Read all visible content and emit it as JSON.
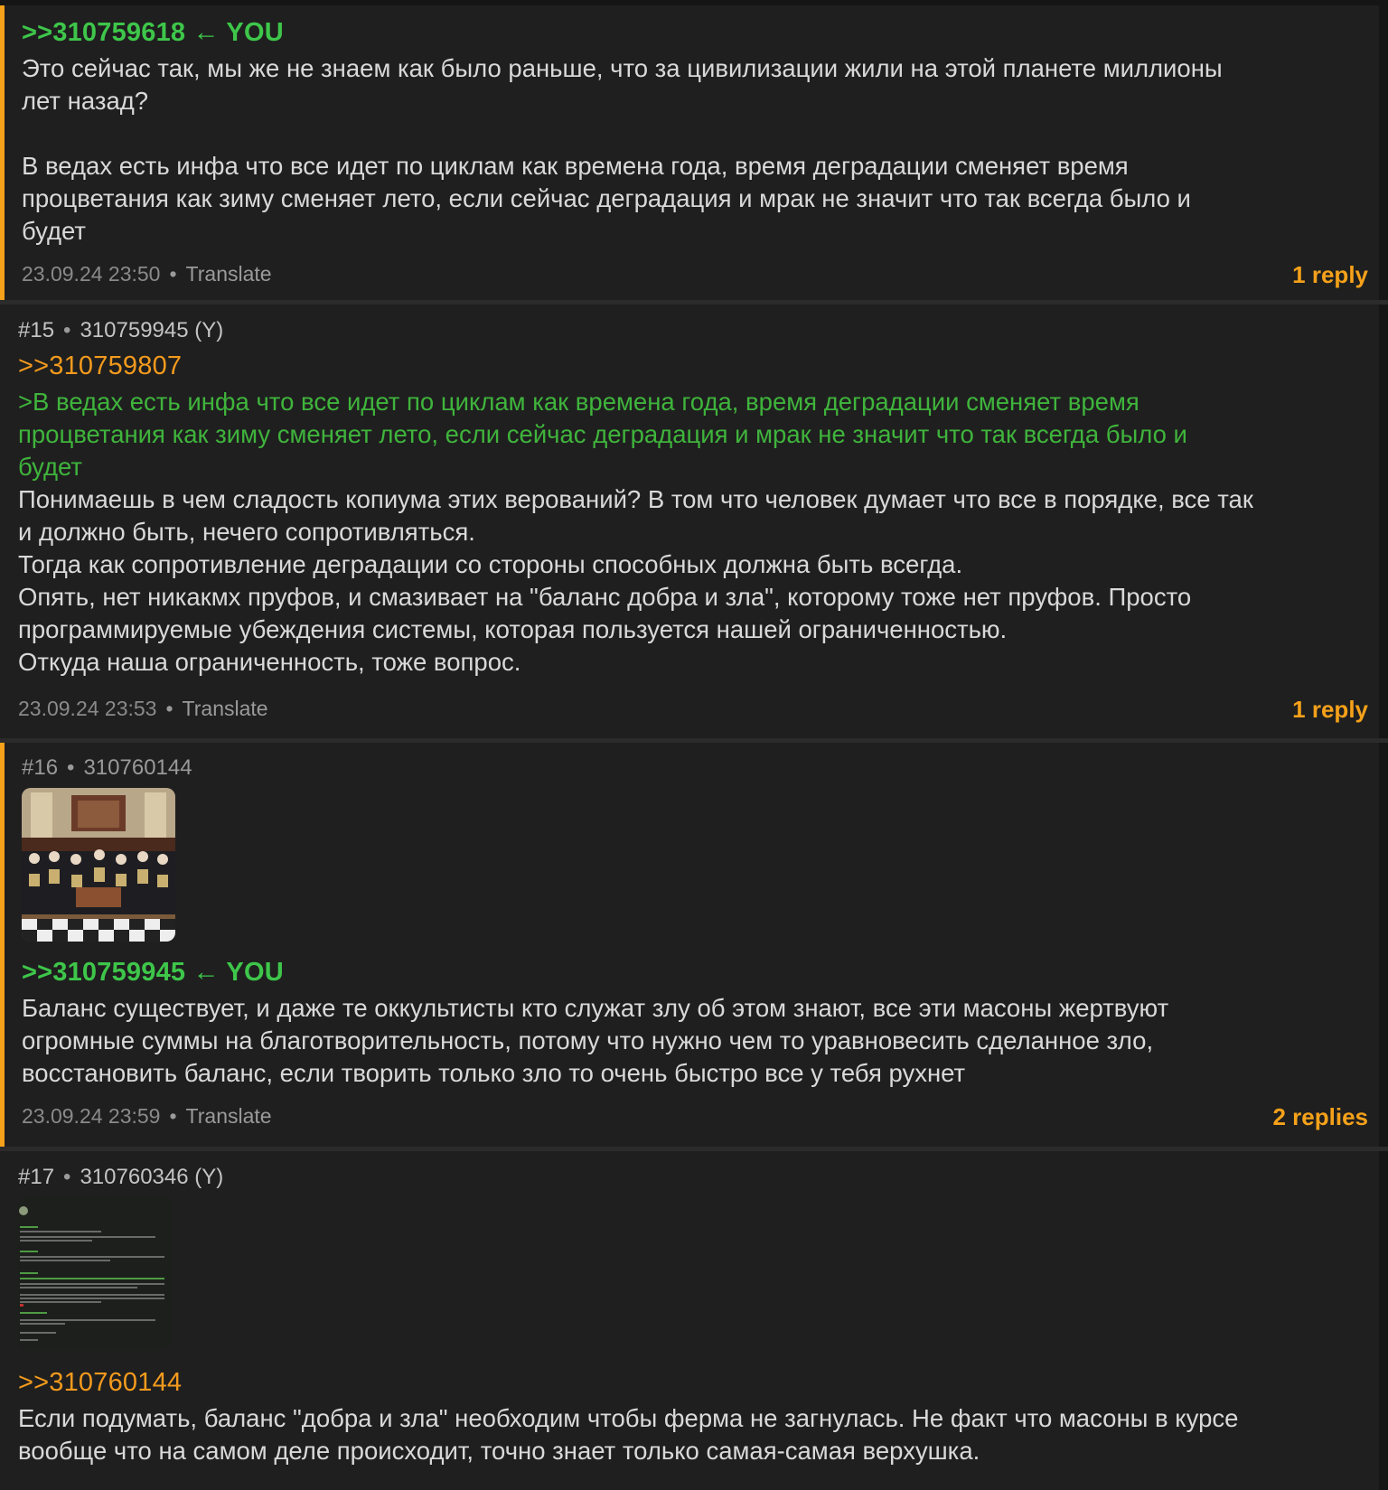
{
  "posts": [
    {
      "reply_to": ">>310759618",
      "you_marker": "← YOU",
      "lines": [
        "Это сейчас так, мы же не знаем как было раньше, что за цивилизации жили на этой планете миллионы",
        "лет назад?",
        "",
        "В ведах есть инфа что все идет по циклам как времена года, время деградации сменяет время",
        "процветания как зиму сменяет лето, если сейчас деградация и мрак не значит что так всегда было и",
        "будет"
      ],
      "date": "23.09.24 23:50",
      "translate": "Translate",
      "replies": "1 reply"
    },
    {
      "num": "#15",
      "id": "310759945 (Y)",
      "reply_to": ">>310759807",
      "quote_lines": [
        ">В ведах есть инфа что все идет по циклам как времена года, время деградации сменяет время",
        "процветания как зиму сменяет лето, если сейчас деградация и мрак не значит что так всегда было и",
        "будет"
      ],
      "lines": [
        "Понимаешь в чем сладость копиума этих верований? В том что человек думает что все в порядке, все так",
        "и должно быть, нечего сопротивляться.",
        "Тогда как сопротивление деградации со стороны способных должна быть всегда.",
        "Опять, нет никакмх пруфов, и смазивает на \"баланс добра и зла\", которому тоже нет пруфов. Просто",
        "программируемые убеждения системы, которая пользуется нашей ограниченностью.",
        "Откуда наша ограниченность, тоже вопрос."
      ],
      "date": "23.09.24 23:53",
      "translate": "Translate",
      "replies": "1 reply"
    },
    {
      "num": "#16",
      "id": "310760144",
      "reply_to": ">>310759945",
      "you_marker": "← YOU",
      "lines": [
        "Баланс существует, и даже те оккультисты кто служат злу об этом знают, все эти масоны жертвуют",
        "огромные суммы на благотворительность, потому что нужно чем то уравновесить сделанное зло,",
        "восстановить баланс, если творить только зло то очень быстро все у тебя рухнет"
      ],
      "date": "23.09.24 23:59",
      "translate": "Translate",
      "replies": "2 replies"
    },
    {
      "num": "#17",
      "id": "310760346 (Y)",
      "reply_to": ">>310760144",
      "lines": [
        "Если подумать, баланс \"добра и зла\" необходим чтобы ферма не загнулась. Не факт что масоны в курсе",
        "вообще что на самом деле происходит, точно знает только самая-самая верхушка."
      ]
    }
  ],
  "colors": {
    "background": "#151515",
    "post": "#1f1f1f",
    "own_border": "#f5a11a",
    "you_link": "#3ec64a",
    "other_link": "#f39a1d",
    "greentext": "#3fb43c",
    "replies": "#f5a11a"
  }
}
